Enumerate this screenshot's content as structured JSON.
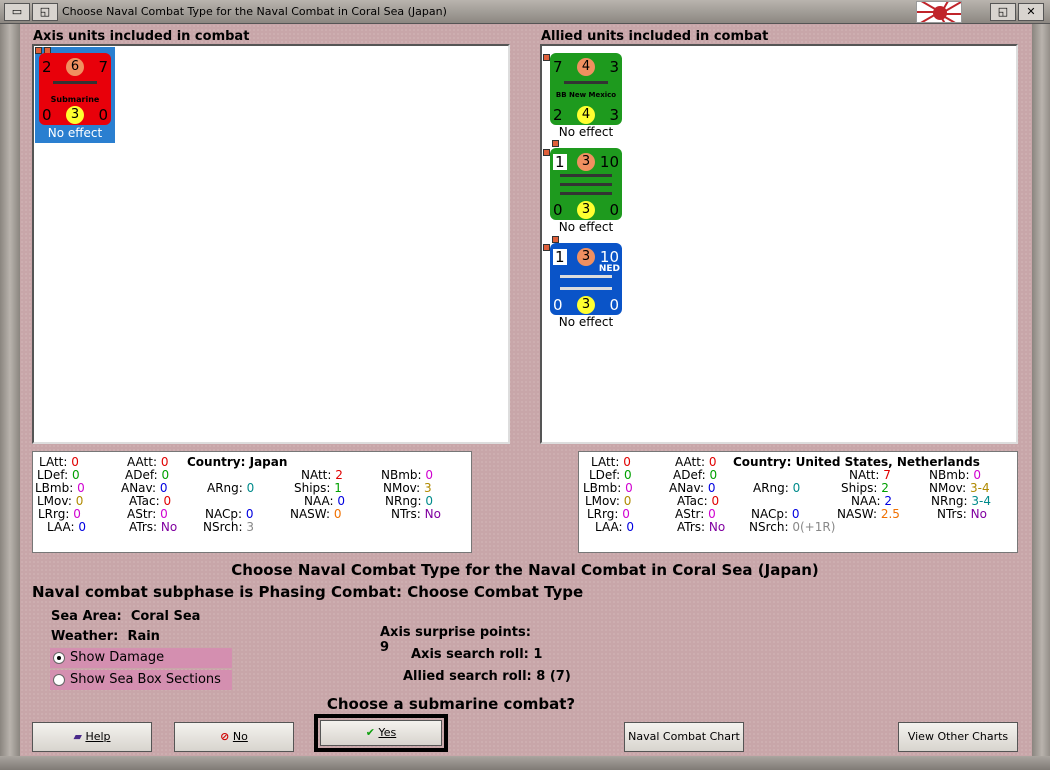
{
  "window": {
    "title": "Choose Naval Combat Type for the Naval Combat in Coral Sea (Japan)"
  },
  "axis": {
    "header": "Axis units included in combat",
    "units": [
      {
        "tl": "2",
        "tc": "6",
        "tr": "7",
        "name": "Submarine",
        "bl": "0",
        "bc": "3",
        "br": "0",
        "effect": "No effect",
        "color": "#e8000a"
      }
    ],
    "stats": {
      "latt_k": "LAtt:",
      "latt_v": "0",
      "ldef_k": "LDef:",
      "ldef_v": "0",
      "lbmb_k": "LBmb:",
      "lbmb_v": "0",
      "lmov_k": "LMov:",
      "lmov_v": "0",
      "lrrg_k": "LRrg:",
      "lrrg_v": "0",
      "laa_k": "LAA:",
      "laa_v": "0",
      "aatt_k": "AAtt:",
      "aatt_v": "0",
      "adef_k": "ADef:",
      "adef_v": "0",
      "anav_k": "ANav:",
      "anav_v": "0",
      "atac_k": "ATac:",
      "atac_v": "0",
      "astr_k": "AStr:",
      "astr_v": "0",
      "atrs_k": "ATrs:",
      "atrs_v": "No",
      "country_k": "Country:",
      "country_v": "Japan",
      "arng_k": "ARng:",
      "arng_v": "0",
      "nacp_k": "NACp:",
      "nacp_v": "0",
      "nsrch_k": "NSrch:",
      "nsrch_v": "3",
      "natt_k": "NAtt:",
      "natt_v": "2",
      "ships_k": "Ships:",
      "ships_v": "1",
      "naa_k": "NAA:",
      "naa_v": "0",
      "nasw_k": "NASW:",
      "nasw_v": "0",
      "nbmb_k": "NBmb:",
      "nbmb_v": "0",
      "nmov_k": "NMov:",
      "nmov_v": "3",
      "nrng_k": "NRng:",
      "nrng_v": "0",
      "ntrs_k": "NTrs:",
      "ntrs_v": "No"
    }
  },
  "allied": {
    "header": "Allied units included in combat",
    "units": [
      {
        "tl": "7",
        "tc": "4",
        "tr": "3",
        "name": "BB New Mexico",
        "bl": "2",
        "bc": "4",
        "br": "3",
        "effect": "No effect",
        "color": "#1e9a1e"
      },
      {
        "tl": "1",
        "tc": "3",
        "tr": "10",
        "name": "",
        "bl": "0",
        "bc": "3",
        "br": "0",
        "effect": "No effect",
        "color": "#1e9a1e"
      },
      {
        "tl": "1",
        "tc": "3",
        "tr": "10",
        "name": "NED",
        "bl": "0",
        "bc": "3",
        "br": "0",
        "effect": "No effect",
        "color": "#0a54c8"
      }
    ],
    "stats": {
      "latt_k": "LAtt:",
      "latt_v": "0",
      "ldef_k": "LDef:",
      "ldef_v": "0",
      "lbmb_k": "LBmb:",
      "lbmb_v": "0",
      "lmov_k": "LMov:",
      "lmov_v": "0",
      "lrrg_k": "LRrg:",
      "lrrg_v": "0",
      "laa_k": "LAA:",
      "laa_v": "0",
      "aatt_k": "AAtt:",
      "aatt_v": "0",
      "adef_k": "ADef:",
      "adef_v": "0",
      "anav_k": "ANav:",
      "anav_v": "0",
      "atac_k": "ATac:",
      "atac_v": "0",
      "astr_k": "AStr:",
      "astr_v": "0",
      "atrs_k": "ATrs:",
      "atrs_v": "No",
      "country_k": "Country:",
      "country_v": "United States, Netherlands",
      "arng_k": "ARng:",
      "arng_v": "0",
      "nacp_k": "NACp:",
      "nacp_v": "0",
      "nsrch_k": "NSrch:",
      "nsrch_v": "0(+1R)",
      "natt_k": "NAtt:",
      "natt_v": "7",
      "ships_k": "Ships:",
      "ships_v": "2",
      "naa_k": "NAA:",
      "naa_v": "2",
      "nasw_k": "NASW:",
      "nasw_v": "2.5",
      "nbmb_k": "NBmb:",
      "nbmb_v": "0",
      "nmov_k": "NMov:",
      "nmov_v": "3-4",
      "nrng_k": "NRng:",
      "nrng_v": "3-4",
      "ntrs_k": "NTrs:",
      "ntrs_v": "No"
    }
  },
  "main": {
    "title": "Choose Naval Combat Type for the Naval Combat in Coral Sea (Japan)",
    "subphase": "Naval combat subphase is Phasing Combat: Choose Combat Type",
    "sea_area_k": "Sea Area:",
    "sea_area_v": "Coral Sea",
    "weather_k": "Weather:",
    "weather_v": "Rain",
    "show_damage": "Show Damage",
    "show_sea_box": "Show Sea Box Sections",
    "surprise_k": "Axis surprise points:",
    "surprise_v": "9",
    "axis_search_k": "Axis search roll:",
    "axis_search_v": "1",
    "allied_search_k": "Allied search roll:",
    "allied_search_v": "8 (7)",
    "question": "Choose a submarine combat?"
  },
  "buttons": {
    "help": "Help",
    "no": "No",
    "yes": "Yes",
    "naval_chart": "Naval Combat Chart",
    "other_charts": "View Other Charts"
  }
}
